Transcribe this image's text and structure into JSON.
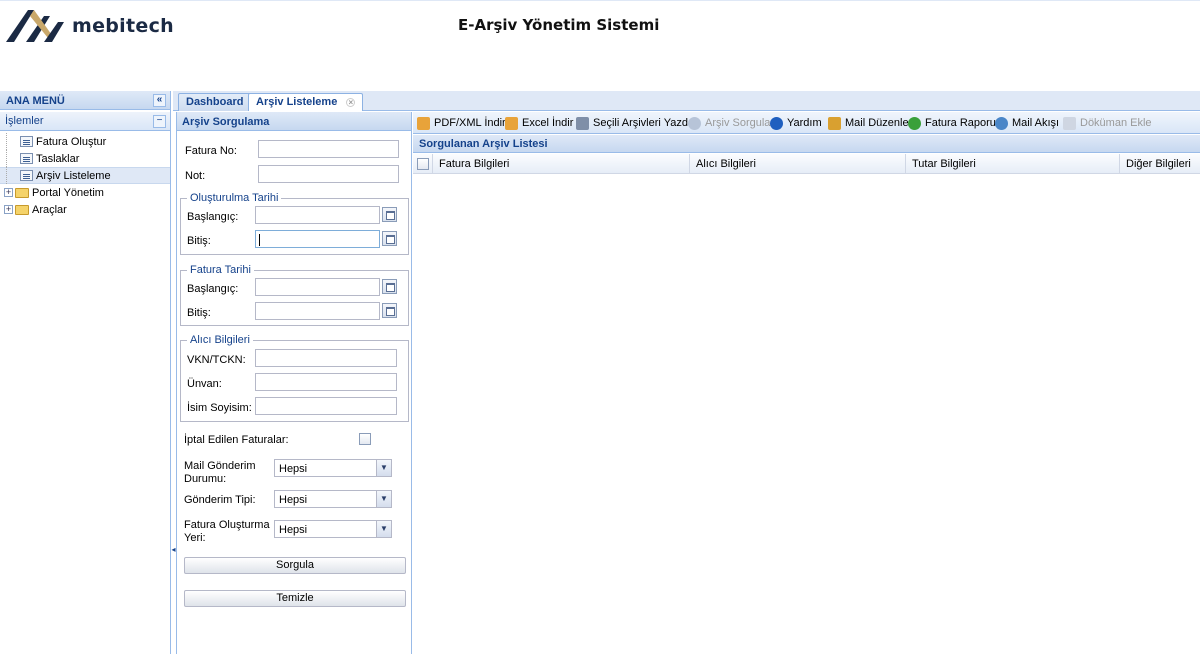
{
  "header": {
    "brand": "mebitech",
    "title": "E-Arşiv Yönetim Sistemi"
  },
  "menu": {
    "title": "ANA MENÜ",
    "collapse_glyph": "«",
    "section": "İşlemler",
    "section_glyph": "−",
    "items": [
      {
        "label": "Fatura Oluştur",
        "type": "leaf"
      },
      {
        "label": "Taslaklar",
        "type": "leaf"
      },
      {
        "label": "Arşiv Listeleme",
        "type": "leaf"
      },
      {
        "label": "Portal Yönetim",
        "type": "folder"
      },
      {
        "label": "Araçlar",
        "type": "folder"
      }
    ]
  },
  "tabs": [
    {
      "label": "Dashboard"
    },
    {
      "label": "Arşiv Listeleme",
      "close": "×"
    }
  ],
  "query": {
    "title": "Arşiv Sorgulama",
    "fatura_no": "Fatura No:",
    "not": "Not:",
    "olusturma_legend": "Oluşturulma Tarihi",
    "fatura_tarihi_legend": "Fatura Tarihi",
    "baslangic": "Başlangıç:",
    "bitis": "Bitiş:",
    "alici_legend": "Alıcı Bilgileri",
    "vkn": "VKN/TCKN:",
    "unvan": "Ünvan:",
    "isim": "İsim Soyisim:",
    "iptal": "İptal Edilen Faturalar:",
    "mail_durum": "Mail Gönderim Durumu:",
    "gonderim_tipi": "Gönderim Tipi:",
    "olusturma_yeri": "Fatura Oluşturma Yeri:",
    "select_value": "Hepsi",
    "select_arrow": "▼",
    "sorgula": "Sorgula",
    "temizle": "Temizle"
  },
  "toolbar": [
    {
      "label": "PDF/XML İndir",
      "color": "#e8a33a",
      "enabled": true
    },
    {
      "label": "Excel İndir",
      "color": "#e8a33a",
      "enabled": true
    },
    {
      "label": "Seçili Arşivleri Yazdır",
      "color": "#7f8fa8",
      "enabled": true
    },
    {
      "label": "Arşiv Sorgula",
      "color": "#b7c4d8",
      "enabled": false
    },
    {
      "label": "Yardım",
      "color": "#1f5fbf",
      "enabled": true
    },
    {
      "label": "Mail Düzenle",
      "color": "#d9a030",
      "enabled": true
    },
    {
      "label": "Fatura Raporu",
      "color": "#3aa03a",
      "enabled": true
    },
    {
      "label": "Mail Akışı",
      "color": "#4a86c8",
      "enabled": true
    },
    {
      "label": "Döküman Ekle",
      "color": "#cfd6e2",
      "enabled": false
    }
  ],
  "list": {
    "title": "Sorgulanan Arşiv Listesi",
    "columns": [
      "Fatura Bilgileri",
      "Alıcı Bilgileri",
      "Tutar Bilgileri",
      "Diğer Bilgileri"
    ]
  },
  "splitter_glyph": "◂"
}
